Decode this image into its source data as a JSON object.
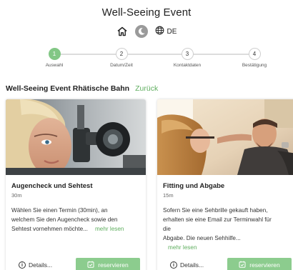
{
  "header": {
    "title": "Well-Seeing Event",
    "language": "DE",
    "icons": [
      "home-icon",
      "moon-icon",
      "globe-icon"
    ]
  },
  "stepper": {
    "steps": [
      {
        "number": "1",
        "label": "Auswahl",
        "active": true
      },
      {
        "number": "2",
        "label": "Datum/Zeit",
        "active": false
      },
      {
        "number": "3",
        "label": "Kontaktdaten",
        "active": false
      },
      {
        "number": "4",
        "label": "Bestätigung",
        "active": false
      }
    ]
  },
  "section": {
    "title": "Well-Seeing Event Rhätische Bahn",
    "back_label": "Zurück"
  },
  "cards": [
    {
      "title": "Augencheck und Sehtest",
      "duration": "30m",
      "description_lines": [
        "Wählen Sie einen Termin (30min), an",
        "welchem Sie den Augencheck sowie den",
        "Sehtest vornehmen möchte..."
      ],
      "more_label": "mehr lesen",
      "details_label": "Details...",
      "reserve_label": "reservieren"
    },
    {
      "title": "Fitting und Abgabe",
      "duration": "15m",
      "description_lines": [
        "Sofern Sie eine Sehbrille gekauft haben,",
        "erhalten sie eine Email zur Terminwahl für",
        "die",
        "Abgabe. Die neuen Sehhilfe..."
      ],
      "more_label": "mehr lesen",
      "details_label": "Details...",
      "reserve_label": "reservieren"
    }
  ],
  "colors": {
    "accent_green": "#82c785",
    "link_green": "#5fae5f",
    "button_green": "#8ccc8e"
  }
}
